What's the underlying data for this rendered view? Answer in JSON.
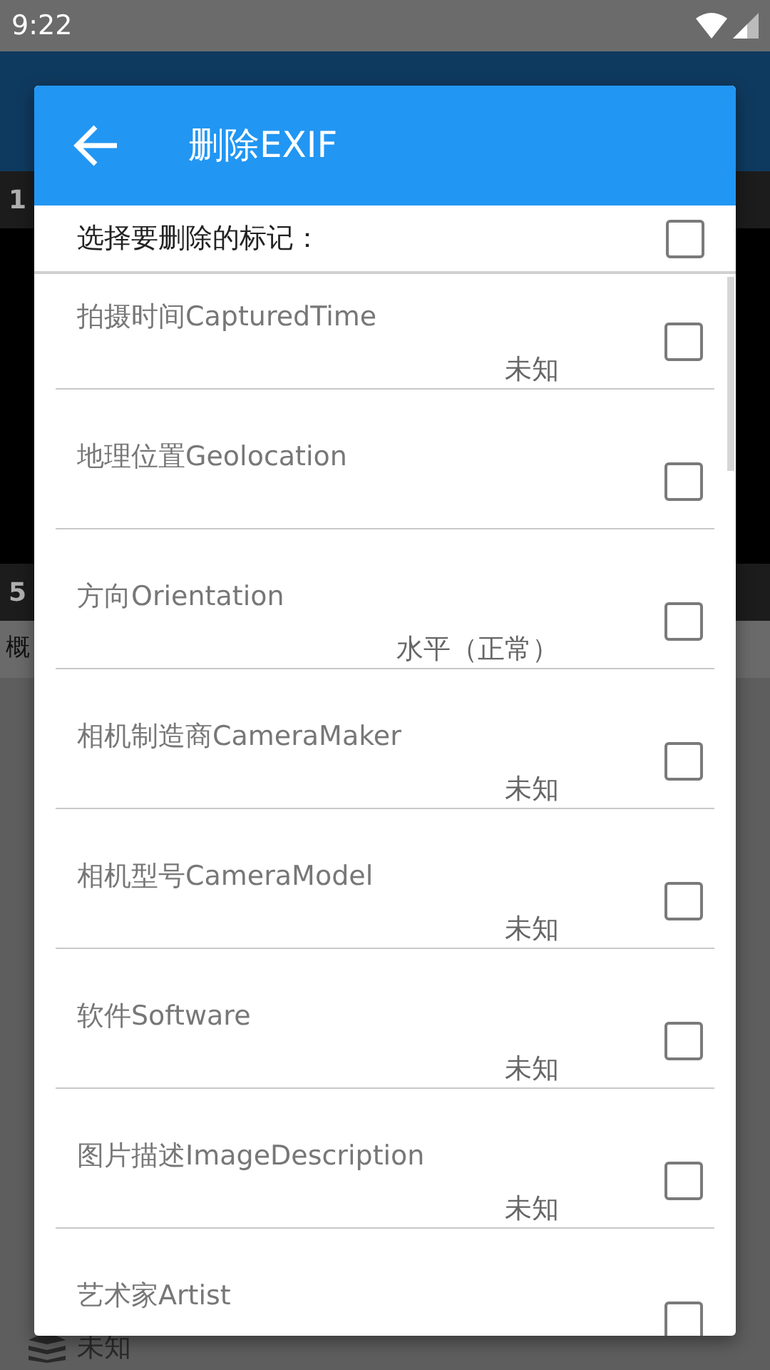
{
  "status_bar": {
    "time": "9:22"
  },
  "background_screen": {
    "strip_1": "1",
    "strip_2": "5",
    "tab": "概",
    "bottom_value": "未知"
  },
  "dialog": {
    "title": "删除EXIF",
    "select_all": {
      "label": "选择要删除的标记：",
      "checked": false
    },
    "items": [
      {
        "name": "拍摄时间CapturedTime",
        "value": "未知",
        "checked": false
      },
      {
        "name": "地理位置Geolocation",
        "checked": false
      },
      {
        "name": "方向Orientation",
        "value": "水平（正常）",
        "checked": false
      },
      {
        "name": "相机制造商CameraMaker",
        "value": "未知",
        "checked": false
      },
      {
        "name": "相机型号CameraModel",
        "value": "未知",
        "checked": false
      },
      {
        "name": "软件Software",
        "value": "未知",
        "checked": false
      },
      {
        "name": "图片描述ImageDescription",
        "value": "未知",
        "checked": false
      },
      {
        "name": "艺术家Artist",
        "checked": false
      }
    ]
  }
}
